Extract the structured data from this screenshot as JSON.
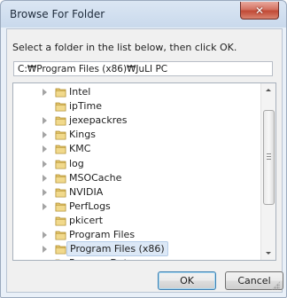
{
  "window": {
    "title": "Browse For Folder",
    "close_label": "✕"
  },
  "instruction": "Select a folder in the list below, then click OK.",
  "path_value": "C:₩Program Files (x86)₩JuLI PC",
  "tree": {
    "items": [
      {
        "label": "Intel",
        "expandable": true
      },
      {
        "label": "ipTime",
        "expandable": false
      },
      {
        "label": "jexepackres",
        "expandable": true
      },
      {
        "label": "Kings",
        "expandable": true
      },
      {
        "label": "KMC",
        "expandable": true
      },
      {
        "label": "log",
        "expandable": true
      },
      {
        "label": "MSOCache",
        "expandable": true
      },
      {
        "label": "NVIDIA",
        "expandable": true
      },
      {
        "label": "PerfLogs",
        "expandable": true
      },
      {
        "label": "pkicert",
        "expandable": false
      },
      {
        "label": "Program Files",
        "expandable": true
      },
      {
        "label": "Program Files (x86)",
        "expandable": true,
        "selected": true
      },
      {
        "label": "ProgramData",
        "expandable": true
      }
    ]
  },
  "buttons": {
    "ok": "OK",
    "cancel": "Cancel"
  },
  "colors": {
    "folder": "#e2c36a",
    "selection": "#dce8f6",
    "accent": "#3c7fb1"
  }
}
